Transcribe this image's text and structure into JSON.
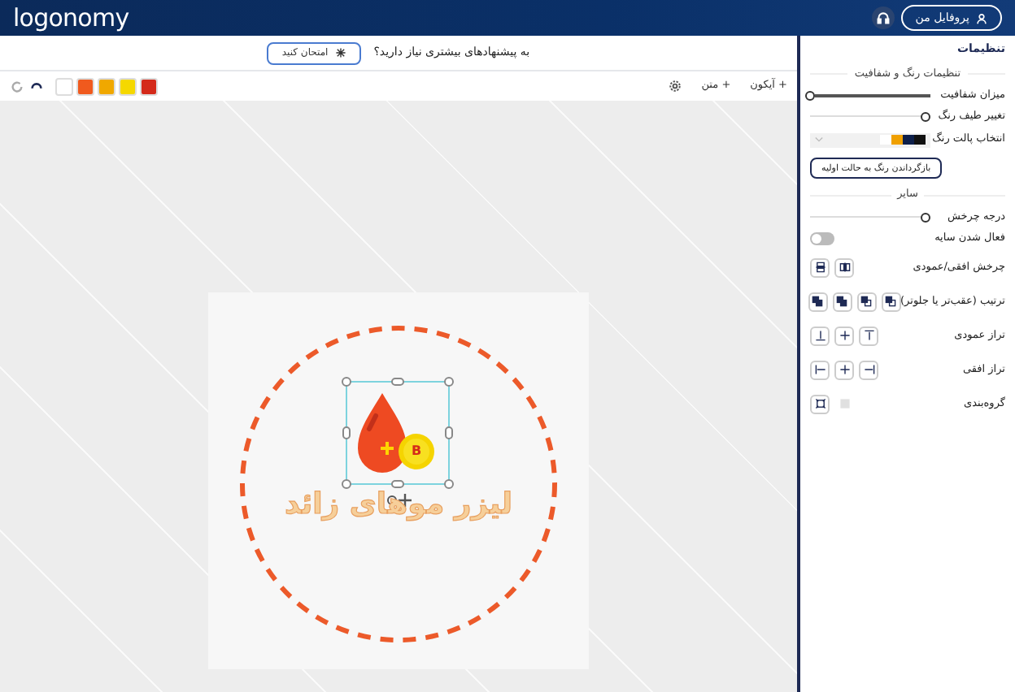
{
  "header": {
    "logo": "logonomy",
    "profile_button": "پروفایل من"
  },
  "suggestion": {
    "text": "به پیشنهادهای بیشتری نیاز دارید؟",
    "button": "امتحان کنید"
  },
  "toolbar": {
    "add_icon": "+ آیکون",
    "add_text": "+ متن",
    "swatches": [
      {
        "color": "#d42a1a"
      },
      {
        "color": "#f5d800"
      },
      {
        "color": "#f0a800"
      },
      {
        "color": "#f05a1e"
      },
      {
        "color": "#ffffff"
      }
    ]
  },
  "canvas": {
    "logo_text": "لیزر موهای زائد",
    "badge_letter": "B"
  },
  "sidebar": {
    "title": "تنظیمات",
    "color_section": "تنظیمات رنگ و شفافیت",
    "opacity": {
      "label": "میزان شفافیت",
      "level": 1
    },
    "hue": {
      "label": "تغییر طیف رنگ",
      "level": 0.04
    },
    "palette": {
      "label": "انتخاب پالت رنگ",
      "colors": [
        {
          "color": "#111111"
        },
        {
          "color": "#0d1f4a"
        },
        {
          "color": "#f0a000"
        },
        {
          "color": "#ffffff"
        }
      ]
    },
    "reset_button": "بازگرداندن رنگ به حالت اولیه",
    "other_section": "سایر",
    "rotation": {
      "label": "درجه چرخش",
      "level": 0.04
    },
    "shadow": {
      "label": "فعال شدن سایه",
      "on": false
    },
    "tool_rows": [
      {
        "label": "چرخش افقی/عمودی",
        "buttons": [
          {
            "kind": "flip-h",
            "disabled": false
          },
          {
            "kind": "flip-v",
            "disabled": false
          }
        ]
      },
      {
        "label": "ترتیب (عقب‌تر یا جلوتر)",
        "buttons": [
          {
            "kind": "front",
            "disabled": false
          },
          {
            "kind": "forward",
            "disabled": false
          },
          {
            "kind": "backward",
            "disabled": false
          },
          {
            "kind": "back",
            "disabled": false
          }
        ]
      },
      {
        "label": "تراز عمودی",
        "buttons": [
          {
            "kind": "top",
            "disabled": false
          },
          {
            "kind": "middle",
            "disabled": false
          },
          {
            "kind": "bottom",
            "disabled": false
          }
        ]
      },
      {
        "label": "تراز افقی",
        "buttons": [
          {
            "kind": "right",
            "disabled": false
          },
          {
            "kind": "center",
            "disabled": false
          },
          {
            "kind": "left",
            "disabled": false
          }
        ]
      },
      {
        "label": "گروه‌بندی",
        "buttons": [
          {
            "kind": "ungroup",
            "disabled": true
          },
          {
            "kind": "group",
            "disabled": false
          }
        ]
      }
    ]
  }
}
